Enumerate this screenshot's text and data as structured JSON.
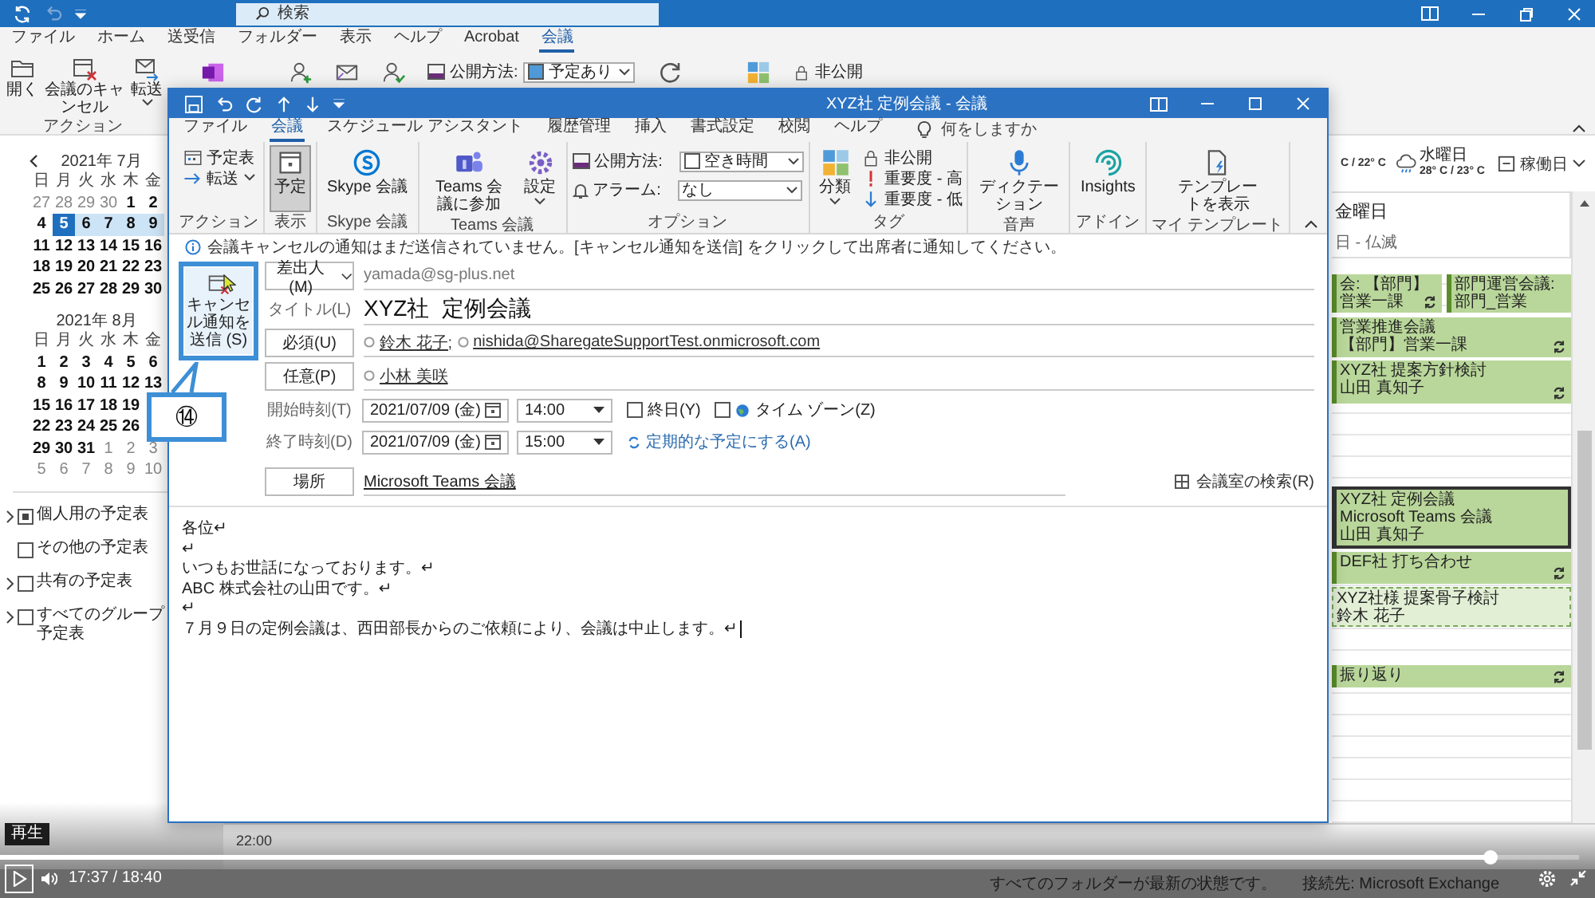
{
  "main_window": {
    "search": {
      "placeholder": "検索"
    },
    "tabs": [
      {
        "label": "ファイル",
        "selected": false
      },
      {
        "label": "ホーム",
        "selected": false
      },
      {
        "label": "送受信",
        "selected": false
      },
      {
        "label": "フォルダー",
        "selected": false
      },
      {
        "label": "表示",
        "selected": false
      },
      {
        "label": "ヘルプ",
        "selected": false
      },
      {
        "label": "Acrobat",
        "selected": false
      },
      {
        "label": "会議",
        "selected": true
      }
    ],
    "ribbon": {
      "buttons": [
        {
          "label": "開く",
          "kind": "folder"
        },
        {
          "label": "会議のキャンセル",
          "kind": "calendar-x"
        },
        {
          "label": "転送",
          "kind": "mail-forward",
          "dropdown": true
        }
      ],
      "group_label": "アクション",
      "show_as": {
        "label": "公開方法:",
        "value": "予定あり"
      },
      "private": "非公開"
    },
    "mini_calendars": [
      {
        "title": "2021年 7月",
        "weekdays": [
          "日",
          "月",
          "火",
          "水",
          "木",
          "金"
        ],
        "weeks": [
          {
            "days": [
              {
                "day": "27",
                "dim": true,
                "selected": false,
                "highlighted": false
              },
              {
                "day": "28",
                "dim": true,
                "selected": false,
                "highlighted": false
              },
              {
                "day": "29",
                "dim": true,
                "selected": false,
                "highlighted": false
              },
              {
                "day": "30",
                "dim": true,
                "selected": false,
                "highlighted": false
              },
              {
                "day": "1",
                "dim": false,
                "selected": false,
                "highlighted": false
              },
              {
                "day": "2",
                "dim": false,
                "selected": false,
                "highlighted": false
              }
            ]
          },
          {
            "days": [
              {
                "day": "4",
                "dim": false,
                "selected": false,
                "highlighted": false
              },
              {
                "day": "5",
                "dim": false,
                "selected": true,
                "highlighted": true
              },
              {
                "day": "6",
                "dim": false,
                "selected": false,
                "highlighted": true
              },
              {
                "day": "7",
                "dim": false,
                "selected": false,
                "highlighted": true
              },
              {
                "day": "8",
                "dim": false,
                "selected": false,
                "highlighted": true
              },
              {
                "day": "9",
                "dim": false,
                "selected": false,
                "highlighted": true
              }
            ]
          },
          {
            "days": [
              {
                "day": "11",
                "dim": false,
                "selected": false,
                "highlighted": false
              },
              {
                "day": "12",
                "dim": false,
                "selected": false,
                "highlighted": false
              },
              {
                "day": "13",
                "dim": false,
                "selected": false,
                "highlighted": false
              },
              {
                "day": "14",
                "dim": false,
                "selected": false,
                "highlighted": false
              },
              {
                "day": "15",
                "dim": false,
                "selected": false,
                "highlighted": false
              },
              {
                "day": "16",
                "dim": false,
                "selected": false,
                "highlighted": false
              }
            ]
          },
          {
            "days": [
              {
                "day": "18",
                "dim": false,
                "selected": false,
                "highlighted": false
              },
              {
                "day": "19",
                "dim": false,
                "selected": false,
                "highlighted": false
              },
              {
                "day": "20",
                "dim": false,
                "selected": false,
                "highlighted": false
              },
              {
                "day": "21",
                "dim": false,
                "selected": false,
                "highlighted": false
              },
              {
                "day": "22",
                "dim": false,
                "selected": false,
                "highlighted": false
              },
              {
                "day": "23",
                "dim": false,
                "selected": false,
                "highlighted": false
              }
            ]
          },
          {
            "days": [
              {
                "day": "25",
                "dim": false,
                "selected": false,
                "highlighted": false
              },
              {
                "day": "26",
                "dim": false,
                "selected": false,
                "highlighted": false
              },
              {
                "day": "27",
                "dim": false,
                "selected": false,
                "highlighted": false
              },
              {
                "day": "28",
                "dim": false,
                "selected": false,
                "highlighted": false
              },
              {
                "day": "29",
                "dim": false,
                "selected": false,
                "highlighted": false
              },
              {
                "day": "30",
                "dim": false,
                "selected": false,
                "highlighted": false
              }
            ]
          }
        ]
      },
      {
        "title": "2021年 8月",
        "weekdays": [
          "日",
          "月",
          "火",
          "水",
          "木",
          "金"
        ],
        "weeks": [
          {
            "days": [
              {
                "day": "1",
                "dim": false,
                "selected": false,
                "highlighted": false
              },
              {
                "day": "2",
                "dim": false,
                "selected": false,
                "highlighted": false
              },
              {
                "day": "3",
                "dim": false,
                "selected": false,
                "highlighted": false
              },
              {
                "day": "4",
                "dim": false,
                "selected": false,
                "highlighted": false
              },
              {
                "day": "5",
                "dim": false,
                "selected": false,
                "highlighted": false
              },
              {
                "day": "6",
                "dim": false,
                "selected": false,
                "highlighted": false
              }
            ]
          },
          {
            "days": [
              {
                "day": "8",
                "dim": false,
                "selected": false,
                "highlighted": false
              },
              {
                "day": "9",
                "dim": false,
                "selected": false,
                "highlighted": false
              },
              {
                "day": "10",
                "dim": false,
                "selected": false,
                "highlighted": false
              },
              {
                "day": "11",
                "dim": false,
                "selected": false,
                "highlighted": false
              },
              {
                "day": "12",
                "dim": false,
                "selected": false,
                "highlighted": false
              },
              {
                "day": "13",
                "dim": false,
                "selected": false,
                "highlighted": false
              }
            ]
          },
          {
            "days": [
              {
                "day": "15",
                "dim": false,
                "selected": false,
                "highlighted": false
              },
              {
                "day": "16",
                "dim": false,
                "selected": false,
                "highlighted": false
              },
              {
                "day": "17",
                "dim": false,
                "selected": false,
                "highlighted": false
              },
              {
                "day": "18",
                "dim": false,
                "selected": false,
                "highlighted": false
              },
              {
                "day": "19",
                "dim": false,
                "selected": false,
                "highlighted": false
              }
            ]
          },
          {
            "days": [
              {
                "day": "22",
                "dim": false,
                "selected": false,
                "highlighted": false
              },
              {
                "day": "23",
                "dim": false,
                "selected": false,
                "highlighted": false
              },
              {
                "day": "24",
                "dim": false,
                "selected": false,
                "highlighted": false
              },
              {
                "day": "25",
                "dim": false,
                "selected": false,
                "highlighted": false
              },
              {
                "day": "26",
                "dim": false,
                "selected": false,
                "highlighted": false
              }
            ]
          },
          {
            "days": [
              {
                "day": "29",
                "dim": false,
                "selected": false,
                "highlighted": false
              },
              {
                "day": "30",
                "dim": false,
                "selected": false,
                "highlighted": false
              },
              {
                "day": "31",
                "dim": false,
                "selected": false,
                "highlighted": false
              },
              {
                "day": "1",
                "dim": true,
                "selected": false,
                "highlighted": false
              },
              {
                "day": "2",
                "dim": true,
                "selected": false,
                "highlighted": false
              },
              {
                "day": "3",
                "dim": true,
                "selected": false,
                "highlighted": false
              }
            ]
          },
          {
            "days": [
              {
                "day": "5",
                "dim": true,
                "selected": false,
                "highlighted": false
              },
              {
                "day": "6",
                "dim": true,
                "selected": false,
                "highlighted": false
              },
              {
                "day": "7",
                "dim": true,
                "selected": false,
                "highlighted": false
              },
              {
                "day": "8",
                "dim": true,
                "selected": false,
                "highlighted": false
              },
              {
                "day": "9",
                "dim": true,
                "selected": false,
                "highlighted": false
              },
              {
                "day": "10",
                "dim": true,
                "selected": false,
                "highlighted": false
              }
            ]
          }
        ]
      }
    ],
    "calendar_list": [
      {
        "label": "個人用の予定表",
        "checked": true,
        "expandable": true
      },
      {
        "label": "その他の予定表",
        "checked": false,
        "expandable": false
      },
      {
        "label": "共有の予定表",
        "checked": false,
        "expandable": true
      },
      {
        "label": "すべてのグループ予定表",
        "checked": false,
        "expandable": true
      }
    ],
    "weather": [
      {
        "kind": "partial",
        "temps": "C / 22° C"
      },
      {
        "kind": "rain",
        "day": "水曜日",
        "temps": "28° C / 23° C"
      }
    ],
    "view_switch": "稼働日",
    "day_header": {
      "day": "金曜日",
      "note": "日 - 仏滅"
    },
    "events": [
      {
        "lines": [
          "会: 【部門】営業一課"
        ],
        "recurring": true,
        "selected": false,
        "tentative": false
      },
      {
        "lines": [
          "部門運営会議: 部門_営業"
        ],
        "recurring": false,
        "selected": false,
        "tentative": false
      },
      {
        "lines": [
          "営業推進会議",
          "【部門】営業一課"
        ],
        "recurring": true,
        "selected": false,
        "tentative": false
      },
      {
        "lines": [
          "XYZ社 提案方針検討",
          "山田 真知子"
        ],
        "recurring": true,
        "selected": false,
        "tentative": false
      },
      {
        "lines": [
          "XYZ社 定例会議",
          "Microsoft Teams 会議",
          "山田 真知子"
        ],
        "recurring": false,
        "selected": true,
        "tentative": false
      },
      {
        "lines": [
          "DEF社 打ち合わせ"
        ],
        "recurring": true,
        "selected": false,
        "tentative": false
      },
      {
        "lines": [
          "XYZ社様 提案骨子検討",
          "鈴木 花子"
        ],
        "recurring": false,
        "selected": false,
        "tentative": true
      },
      {
        "lines": [
          "振り返り"
        ],
        "recurring": true,
        "selected": false,
        "tentative": false
      }
    ],
    "time_label": "22:00",
    "status_bar": [
      "すべてのフォルダーが最新の状態です。",
      "接続先: Microsoft Exchange"
    ]
  },
  "meeting_window": {
    "title": "XYZ社 定例会議 - 会議",
    "tabs": [
      {
        "label": "ファイル",
        "selected": false
      },
      {
        "label": "会議",
        "selected": true
      },
      {
        "label": "スケジュール アシスタント",
        "selected": false
      },
      {
        "label": "履歴管理",
        "selected": false
      },
      {
        "label": "挿入",
        "selected": false
      },
      {
        "label": "書式設定",
        "selected": false
      },
      {
        "label": "校閲",
        "selected": false
      },
      {
        "label": "ヘルプ",
        "selected": false
      }
    ],
    "tell_me": {
      "placeholder": "何をしますか"
    },
    "ribbon_groups": [
      {
        "label": "アクション",
        "items": [
          {
            "kind": "calendar",
            "label": "予定表"
          },
          {
            "kind": "forward",
            "label": "転送",
            "dropdown": true
          }
        ]
      },
      {
        "label": "表示",
        "items": [
          {
            "kind": "appointment",
            "label": "予定",
            "selected": true
          }
        ]
      },
      {
        "label": "Skype 会議",
        "items": [
          {
            "kind": "skype",
            "label": "Skype 会議"
          }
        ]
      },
      {
        "label": "Teams 会議",
        "items": [
          {
            "kind": "teams",
            "label": "Teams 会議に参加"
          },
          {
            "kind": "gear",
            "label": "設定",
            "dropdown": true
          }
        ]
      },
      {
        "label": "オプション",
        "items": [
          {
            "kind": "status",
            "label": "公開方法:",
            "value": "空き時間"
          },
          {
            "kind": "alarm",
            "label": "アラーム:",
            "value": "なし"
          }
        ]
      },
      {
        "label": "タグ",
        "items": [
          {
            "kind": "categorize",
            "label": "分類",
            "dropdown": true
          },
          {
            "kind": "lock",
            "label": "非公開"
          },
          {
            "kind": "high",
            "label": "重要度 - 高"
          },
          {
            "kind": "low",
            "label": "重要度 - 低"
          }
        ]
      },
      {
        "label": "音声",
        "items": [
          {
            "kind": "mic",
            "label": "ディクテーション"
          }
        ]
      },
      {
        "label": "アドイン",
        "items": [
          {
            "kind": "insights",
            "label": "Insights"
          }
        ]
      },
      {
        "label": "マイ テンプレート",
        "items": [
          {
            "kind": "template",
            "label": "テンプレートを表示"
          }
        ]
      }
    ],
    "info_bar": "会議キャンセルの通知はまだ送信されていません。[キャンセル通知を送信] をクリックして出席者に通知してください。",
    "send_button": "キャンセル通知を送信 (S)",
    "from": {
      "button": "差出人(M)",
      "value": "yamada@sg-plus.net"
    },
    "title_field": {
      "label": "タイトル(L)",
      "value": "XYZ社  定例会議"
    },
    "required": {
      "button": "必須(U)",
      "attendees": [
        "鈴木 花子;",
        "nishida@SharegateSupportTest.onmicrosoft.com"
      ]
    },
    "optional": {
      "button": "任意(P)",
      "attendees": [
        "小林 美咲"
      ]
    },
    "start": {
      "label": "開始時刻(T)",
      "date": "2021/07/09 (金)",
      "time": "14:00"
    },
    "end": {
      "label": "終了時刻(D)",
      "date": "2021/07/09 (金)",
      "time": "15:00"
    },
    "all_day": {
      "label": "終日(Y)",
      "checked": false
    },
    "time_zone": {
      "label": "タイム ゾーン(Z)",
      "checked": false
    },
    "recurrence_link": "定期的な予定にする(A)",
    "location": {
      "button": "場所",
      "value": "Microsoft Teams 会議"
    },
    "room_finder": "会議室の検索(R)",
    "body": [
      {
        "text": "各位↵",
        "caret": false
      },
      {
        "text": "↵",
        "caret": false
      },
      {
        "text": "いつもお世話になっております。↵",
        "caret": false
      },
      {
        "text": "ABC 株式会社の山田です。↵",
        "caret": false
      },
      {
        "text": "↵",
        "caret": false
      },
      {
        "text": "７月９日の定例会議は、西田部長からのご依頼により、会議は中止します。↵",
        "caret": true
      }
    ]
  },
  "callout": "⑭",
  "video_player": {
    "tooltip": "再生",
    "time": "17:37 / 18:40",
    "level": 0.943,
    "playing": false
  }
}
